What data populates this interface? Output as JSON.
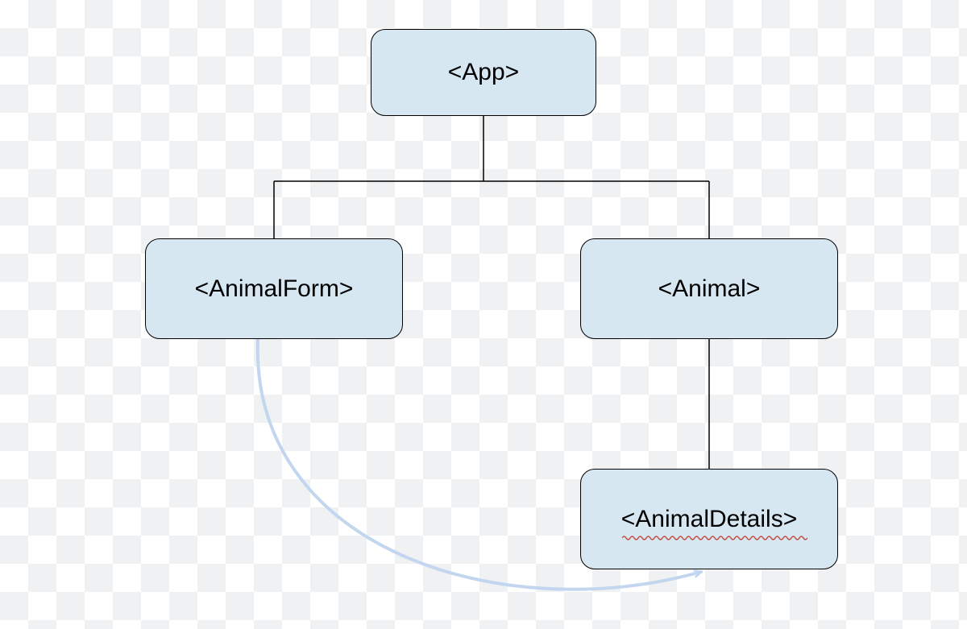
{
  "diagram": {
    "nodes": {
      "app": {
        "label": "<App>"
      },
      "animalForm": {
        "label": "<AnimalForm>"
      },
      "animal": {
        "label": "<Animal>"
      },
      "animalDetails": {
        "label": "<AnimalDetails>"
      }
    },
    "colors": {
      "nodeFill": "#d6e7f2",
      "edge": "#000000",
      "curvedArrow": "#c3d6ef",
      "squiggle": "#c0392b"
    }
  }
}
